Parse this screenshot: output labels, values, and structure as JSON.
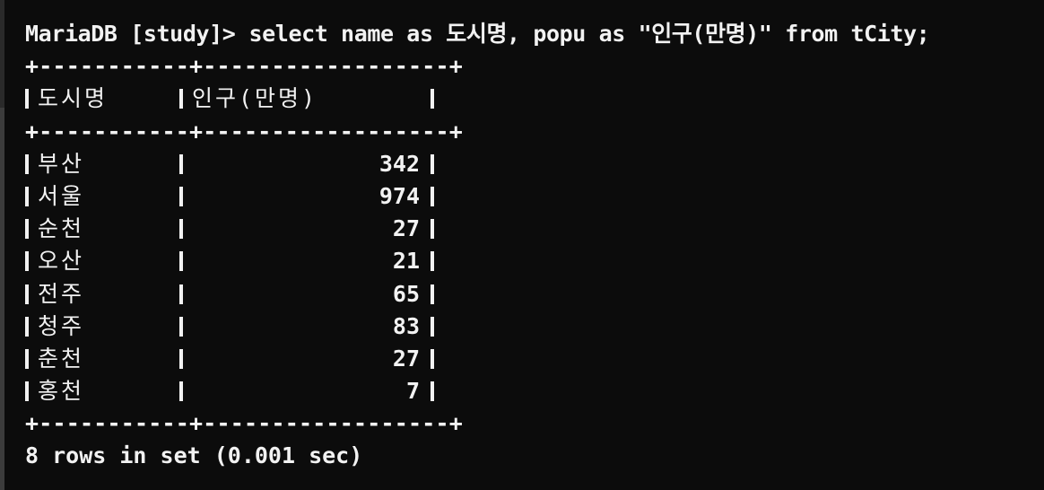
{
  "terminal": {
    "prompt": "MariaDB [study]>",
    "command": "select name as 도시명, popu as \"인구(만명)\" from tCity;",
    "border": "+-----------+------------------+",
    "columns": [
      "도시명",
      "인구(만명)"
    ],
    "rows": [
      {
        "name": "부산",
        "popu": "342"
      },
      {
        "name": "서울",
        "popu": "974"
      },
      {
        "name": "순천",
        "popu": "27"
      },
      {
        "name": "오산",
        "popu": "21"
      },
      {
        "name": "전주",
        "popu": "65"
      },
      {
        "name": "청주",
        "popu": "83"
      },
      {
        "name": "춘천",
        "popu": "27"
      },
      {
        "name": "홍천",
        "popu": "7"
      }
    ],
    "footer": "8 rows in set (0.001 sec)"
  },
  "colors": {
    "background": "#0c0c0c",
    "text": "#f2f2f2"
  }
}
